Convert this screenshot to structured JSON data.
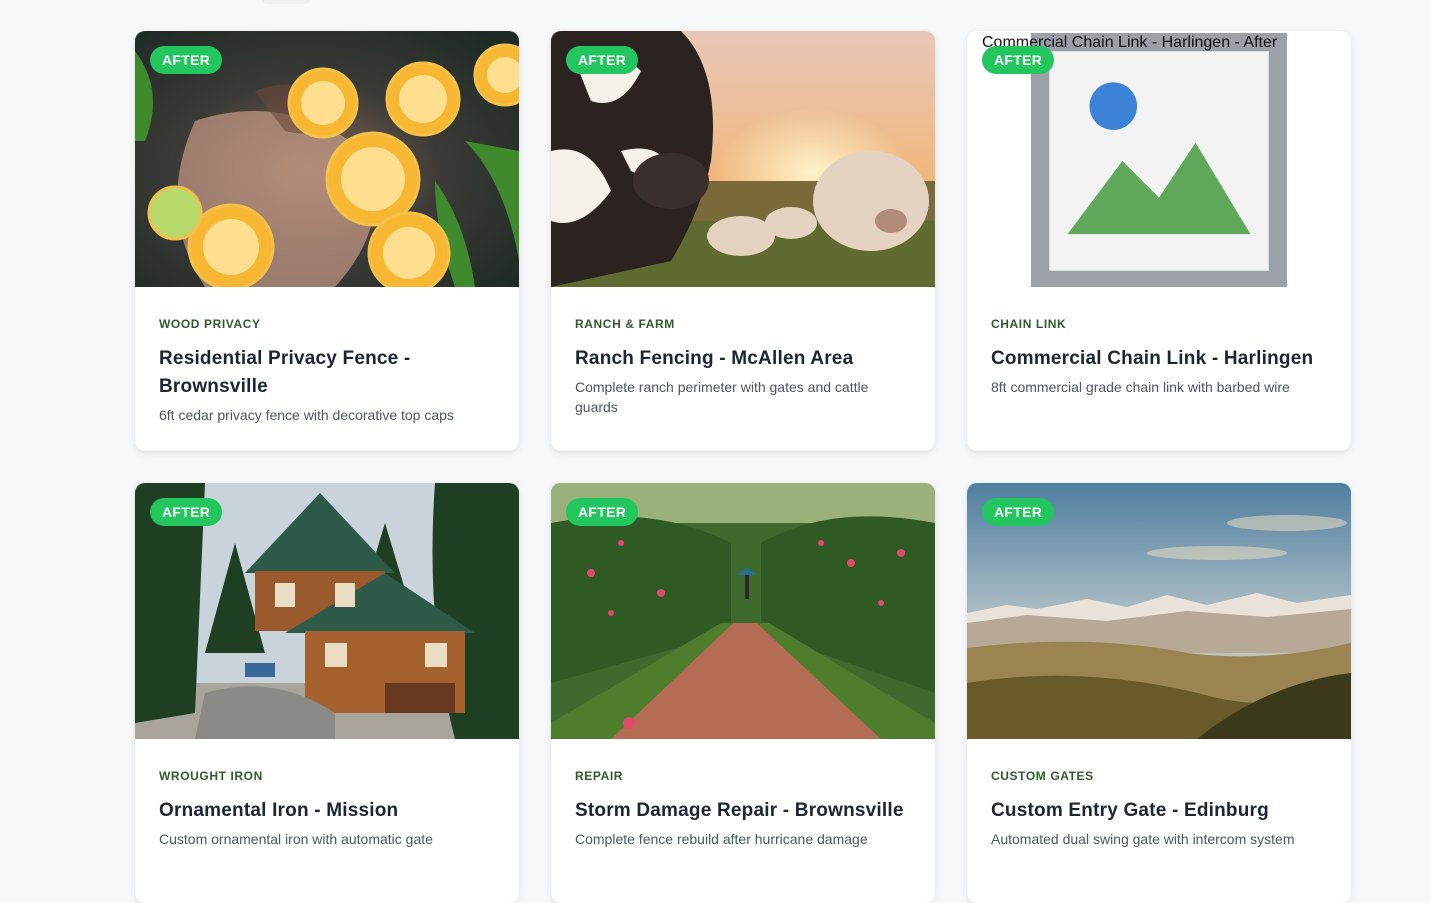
{
  "badge_label": "AFTER",
  "projects": [
    {
      "category": "WOOD PRIVACY",
      "title": "Residential Privacy Fence - Brownsville",
      "description": "6ft cedar privacy fence with decorative top caps",
      "image_alt": ""
    },
    {
      "category": "RANCH & FARM",
      "title": "Ranch Fencing - McAllen Area",
      "description": "Complete ranch perimeter with gates and cattle guards",
      "image_alt": ""
    },
    {
      "category": "CHAIN LINK",
      "title": "Commercial Chain Link - Harlingen",
      "description": "8ft commercial grade chain link with barbed wire",
      "image_alt": "Commercial Chain Link - Harlingen - After"
    },
    {
      "category": "WROUGHT IRON",
      "title": "Ornamental Iron - Mission",
      "description": "Custom ornamental iron with automatic gate",
      "image_alt": ""
    },
    {
      "category": "REPAIR",
      "title": "Storm Damage Repair - Brownsville",
      "description": "Complete fence rebuild after hurricane damage",
      "image_alt": ""
    },
    {
      "category": "CUSTOM GATES",
      "title": "Custom Entry Gate - Edinburg",
      "description": "Automated dual swing gate with intercom system",
      "image_alt": ""
    }
  ],
  "colors": {
    "badge": "#22c55e",
    "category": "#2f5a2c",
    "title": "#1b2533",
    "description": "#4b5563"
  }
}
